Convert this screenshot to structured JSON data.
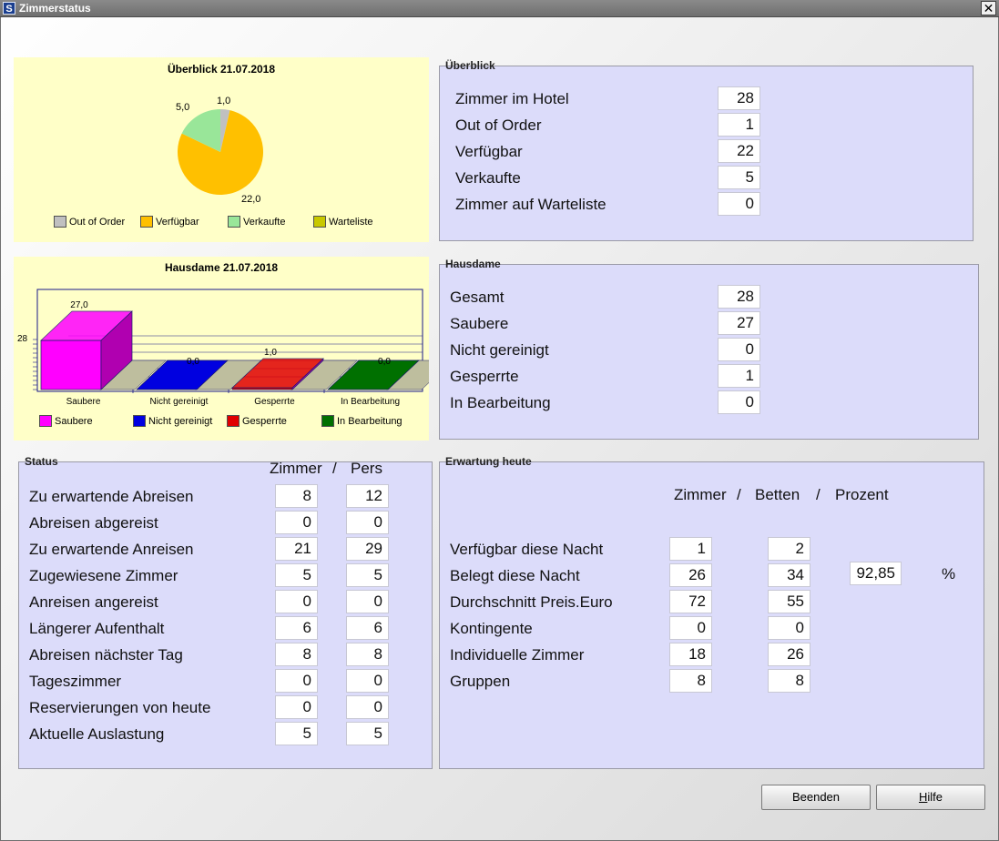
{
  "window": {
    "title": "Zimmerstatus",
    "close_label": "✕",
    "app_icon": "S"
  },
  "pie": {
    "title": "Überblick  21.07.2018",
    "legend": [
      "Out of Order",
      "Verfügbar",
      "Verkaufte",
      "Warteliste"
    ],
    "legend_colors": [
      "#c0c0c0",
      "#ffc000",
      "#99e699",
      "#c8c800"
    ],
    "labels": [
      "1,0",
      "22,0",
      "5,0"
    ],
    "chart_data": {
      "type": "pie",
      "categories": [
        "Out of Order",
        "Verfügbar",
        "Verkaufte",
        "Warteliste"
      ],
      "values": [
        1.0,
        22.0,
        5.0,
        0.0
      ],
      "colors": [
        "#c0c0c0",
        "#ffc000",
        "#99e699",
        "#c8c800"
      ]
    }
  },
  "bar": {
    "title": "Hausdame  21.07.2018",
    "axis_max_label": "28",
    "categories": [
      "Saubere",
      "Nicht gereinigt",
      "Gesperrte",
      "In Bearbeitung"
    ],
    "value_labels": [
      "27,0",
      "0,0",
      "1,0",
      "0,0"
    ],
    "legend": [
      "Saubere",
      "Nicht gereinigt",
      "Gesperrte",
      "In Bearbeitung"
    ],
    "colors": [
      "#ff00ff",
      "#0000e0",
      "#e00000",
      "#007000"
    ],
    "chart_data": {
      "type": "bar",
      "categories": [
        "Saubere",
        "Nicht gereinigt",
        "Gesperrte",
        "In Bearbeitung"
      ],
      "values": [
        27.0,
        0.0,
        1.0,
        0.0
      ],
      "ylim": [
        0,
        28
      ],
      "colors": [
        "#ff00ff",
        "#0000e0",
        "#e00000",
        "#007000"
      ]
    }
  },
  "overview": {
    "title": "Überblick",
    "rows": [
      {
        "label": "Zimmer im Hotel",
        "value": "28"
      },
      {
        "label": "Out of Order",
        "value": "1"
      },
      {
        "label": "Verfügbar",
        "value": "22"
      },
      {
        "label": "Verkaufte",
        "value": "5"
      },
      {
        "label": "Zimmer auf Warteliste",
        "value": "0"
      }
    ]
  },
  "housekeeping": {
    "title": "Hausdame",
    "rows": [
      {
        "label": "Gesamt",
        "value": "28"
      },
      {
        "label": "Saubere",
        "value": "27"
      },
      {
        "label": "Nicht gereinigt",
        "value": "0"
      },
      {
        "label": "Gesperrte",
        "value": "1"
      },
      {
        "label": "In Bearbeitung",
        "value": "0"
      }
    ]
  },
  "status": {
    "title": "Status",
    "col_rooms": "Zimmer",
    "sep": "/",
    "col_pers": "Pers",
    "rows": [
      {
        "label": "Zu erwartende Abreisen",
        "rooms": "8",
        "pers": "12"
      },
      {
        "label": "Abreisen abgereist",
        "rooms": "0",
        "pers": "0"
      },
      {
        "label": "Zu erwartende Anreisen",
        "rooms": "21",
        "pers": "29"
      },
      {
        "label": "Zugewiesene Zimmer",
        "rooms": "5",
        "pers": "5"
      },
      {
        "label": "Anreisen angereist",
        "rooms": "0",
        "pers": "0"
      },
      {
        "label": "Längerer Aufenthalt",
        "rooms": "6",
        "pers": "6"
      },
      {
        "label": "Abreisen nächster Tag",
        "rooms": "8",
        "pers": "8"
      },
      {
        "label": "Tageszimmer",
        "rooms": "0",
        "pers": "0"
      },
      {
        "label": "Reservierungen von heute",
        "rooms": "0",
        "pers": "0"
      },
      {
        "label": "Aktuelle Auslastung",
        "rooms": "5",
        "pers": "5"
      }
    ]
  },
  "expectation": {
    "title": "Erwartung heute",
    "col_rooms": "Zimmer",
    "sep1": "/",
    "col_beds": "Betten",
    "sep2": "/",
    "col_percent": "Prozent",
    "percent_value": "92,85",
    "percent_sign": "%",
    "rows": [
      {
        "label": "Verfügbar diese Nacht",
        "rooms": "1",
        "beds": "2"
      },
      {
        "label": "Belegt diese Nacht",
        "rooms": "26",
        "beds": "34"
      },
      {
        "label": "Durchschnitt Preis.Euro",
        "rooms": "72",
        "beds": "55"
      },
      {
        "label": "Kontingente",
        "rooms": "0",
        "beds": "0"
      },
      {
        "label": "Individuelle Zimmer",
        "rooms": "18",
        "beds": "26"
      },
      {
        "label": "Gruppen",
        "rooms": "8",
        "beds": "8"
      }
    ]
  },
  "buttons": {
    "close": "Beenden",
    "help_first": "H",
    "help_rest": "ilfe"
  }
}
